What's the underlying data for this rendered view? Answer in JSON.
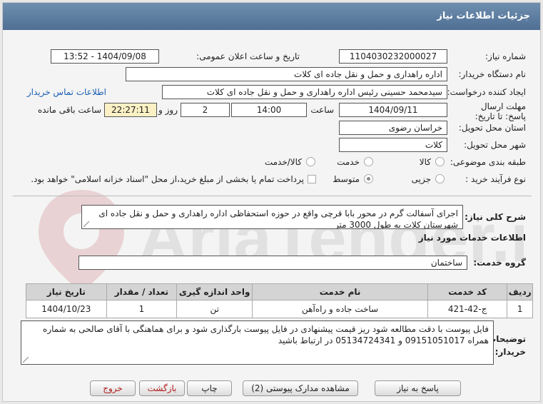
{
  "header": {
    "title": "جزئیات اطلاعات نیاز"
  },
  "fields": {
    "need_number_label": "شماره نیاز:",
    "need_number": "1104030232000027",
    "announce_label": "تاریخ و ساعت اعلان عمومی:",
    "announce_value": "1404/09/08 - 13:52",
    "buyer_org_label": "نام دستگاه خریدار:",
    "buyer_org": "اداره راهداری و حمل و نقل جاده ای کلات",
    "creator_label": "ایجاد کننده درخواست:",
    "creator": "سیدمحمد حسینی رئیس اداره راهداری و حمل و نقل جاده ای کلات",
    "contact_link": "اطلاعات تماس خریدار",
    "deadline_label": "مهلت ارسال پاسخ: تا تاریخ:",
    "deadline_date": "1404/09/11",
    "time_label": "ساعت",
    "deadline_time": "14:00",
    "days_value": "2",
    "days_label": "روز و",
    "remaining_time": "22:27:11",
    "remaining_label": "ساعت باقی مانده",
    "province_label": "استان محل تحویل:",
    "province": "خراسان رضوی",
    "city_label": "شهر محل تحویل:",
    "city": "کلات",
    "category_label": "طبقه بندی موضوعی:",
    "category_options": [
      "کالا",
      "خدمت",
      "کالا/خدمت"
    ],
    "process_label": "نوع فرآیند خرید :",
    "process_options": [
      "جزیی",
      "متوسط"
    ],
    "payment_note": "پرداخت تمام یا بخشی از مبلغ خرید،از محل \"اسناد خزانه اسلامی\" خواهد بود."
  },
  "description": {
    "label": "شرح کلی نیاز:",
    "text": "اجرای  آسفالت گرم  در محور بابا قرچی واقع در حوزه استحفاظی اداره راهداری و حمل و نقل جاده ای شهرستان کلات به طول 3000 متر"
  },
  "services": {
    "section_title": "اطلاعات خدمات مورد نیاز",
    "group_label": "گروه خدمت:",
    "group_value": "ساختمان",
    "columns": [
      "ردیف",
      "کد خدمت",
      "نام خدمت",
      "واحد اندازه گیری",
      "تعداد / مقدار",
      "تاریخ نیاز"
    ],
    "rows": [
      [
        "1",
        "ج-42-421",
        "ساخت جاده و راه‌آهن",
        "تن",
        "1",
        "1404/10/23"
      ]
    ]
  },
  "notes": {
    "label": "توضیحات خریدار:",
    "text": "فایل پیوست با دقت مطالعه شود ریز قیمت پیشنهادی در فایل پیوست بارگذاری شود و برای هماهنگی با آقای صالحی به شماره همراه 09151051017 و 05134724341 در ارتباط باشید"
  },
  "buttons": {
    "reply": "پاسخ به نیاز",
    "attachments": "مشاهده مدارک پیوستی (2)",
    "print": "چاپ",
    "back": "بازگشت",
    "exit": "خروج"
  },
  "watermark": {
    "text": "AriaTender.net"
  },
  "colors": {
    "header": "#56769a",
    "link": "#1a5fb4",
    "highlight": "#fbf1c5"
  }
}
